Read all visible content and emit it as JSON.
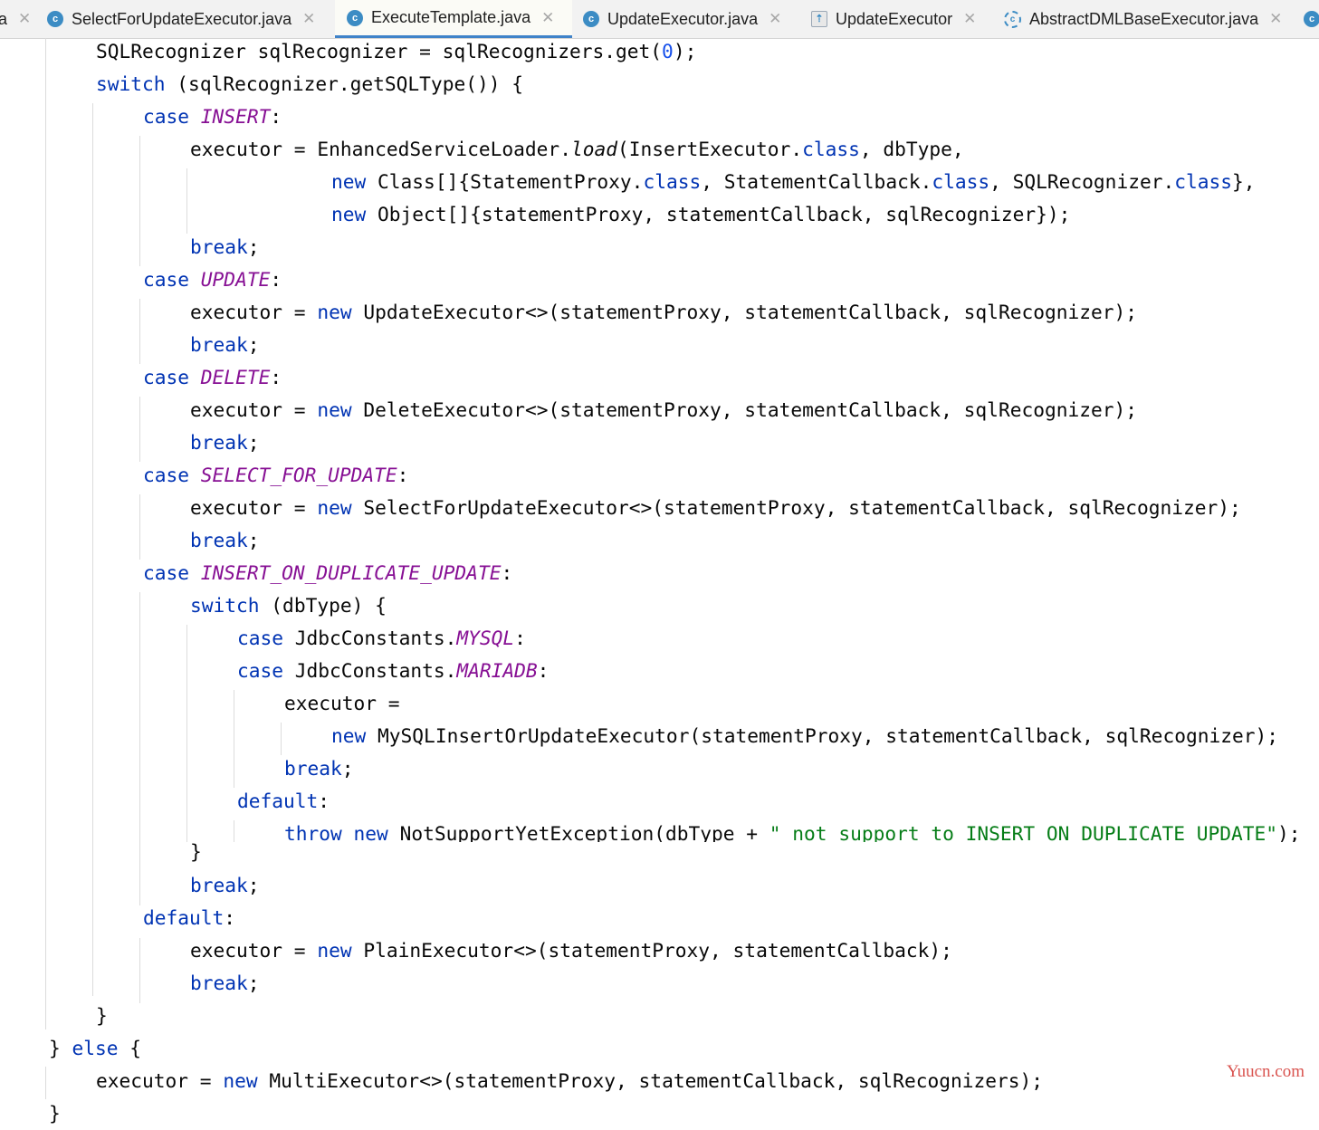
{
  "tabs": [
    {
      "label": "a",
      "active": false,
      "icon": "none"
    },
    {
      "label": "SelectForUpdateExecutor.java",
      "active": false,
      "icon": "class-icon"
    },
    {
      "label": "ExecuteTemplate.java",
      "active": true,
      "icon": "class-icon"
    },
    {
      "label": "UpdateExecutor.java",
      "active": false,
      "icon": "class-icon"
    },
    {
      "label": "UpdateExecutor",
      "active": false,
      "icon": "structure-icon"
    },
    {
      "label": "AbstractDMLBaseExecutor.java",
      "active": false,
      "icon": "abstract-class-icon"
    }
  ],
  "code": {
    "lines": [
      "SQLRecognizer sqlRecognizer = sqlRecognizers.get(0);",
      "switch (sqlRecognizer.getSQLType()) {",
      "case INSERT:",
      "executor = EnhancedServiceLoader.load(InsertExecutor.class, dbType,",
      "new Class[]{StatementProxy.class, StatementCallback.class, SQLRecognizer.class},",
      "new Object[]{statementProxy, statementCallback, sqlRecognizer});",
      "break;",
      "case UPDATE:",
      "executor = new UpdateExecutor<>(statementProxy, statementCallback, sqlRecognizer);",
      "break;",
      "case DELETE:",
      "executor = new DeleteExecutor<>(statementProxy, statementCallback, sqlRecognizer);",
      "break;",
      "case SELECT_FOR_UPDATE:",
      "executor = new SelectForUpdateExecutor<>(statementProxy, statementCallback, sqlRecognizer);",
      "break;",
      "case INSERT_ON_DUPLICATE_UPDATE:",
      "switch (dbType) {",
      "case JdbcConstants.MYSQL:",
      "case JdbcConstants.MARIADB:",
      "executor =",
      "new MySQLInsertOrUpdateExecutor(statementProxy, statementCallback, sqlRecognizer);",
      "break;",
      "default:",
      "throw new NotSupportYetException(dbType + \" not support to INSERT_ON_DUPLICATE_UPDATE\");",
      "}",
      "break;",
      "default:",
      "executor = new PlainExecutor<>(statementProxy, statementCallback);",
      "break;",
      "}",
      "} else {",
      "executor = new MultiExecutor<>(statementProxy, statementCallback, sqlRecognizers);",
      "}"
    ]
  },
  "watermark": "Yuucn.com",
  "colors": {
    "keyword": "#0033b3",
    "constant": "#871094",
    "number": "#1750eb",
    "string": "#067d17",
    "text": "#080808",
    "active_tab_underline": "#4083c9",
    "watermark": "#d9534f"
  }
}
